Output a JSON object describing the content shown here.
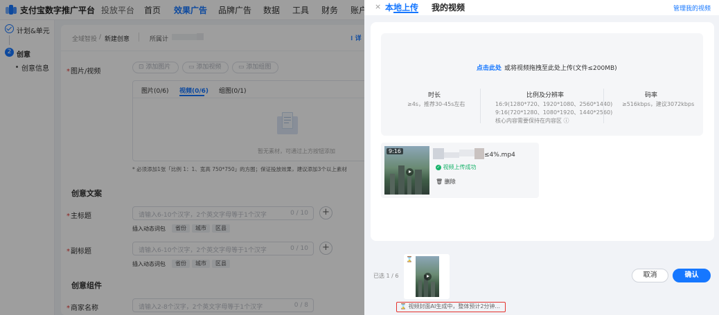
{
  "app": {
    "title": "支付宝数字推广平台",
    "subtitle": "投放平台"
  },
  "nav": [
    "首页",
    "效果广告",
    "品牌广告",
    "数据",
    "工具",
    "财务",
    "账户"
  ],
  "sidebar": {
    "step1": "计划&单元",
    "step2_num": "2",
    "step2": "创意",
    "sub": "创意信息"
  },
  "breadcrumb": {
    "root": "全域智投",
    "sep": "/",
    "current": "新建创意",
    "owner_label": "所属计",
    "detail": "详"
  },
  "media": {
    "label": "图片/视频",
    "buttons": [
      "添加图片",
      "添加视频",
      "添加组图"
    ],
    "tabs": [
      "图片(0/6)",
      "视频(0/6)",
      "组图(0/1)"
    ],
    "empty_text": "暂无素材，可通过上方按钮添加",
    "hint": "* 必须添加1张「比例 1：1、宽高 750*750」的方图；保证投放效果，建议添加3个以上素材"
  },
  "copy": {
    "section_title": "创意文案",
    "main_title": {
      "label": "主标题",
      "placeholder": "请输入6-10个汉字，2个英文字母等于1个汉字",
      "count": "0 / 10"
    },
    "sub_title": {
      "label": "副标题",
      "placeholder": "请输入6-10个汉字，2个英文字母等于1个汉字",
      "count": "0 / 10"
    },
    "insert_label": "插入动态词包",
    "tags": [
      "省份",
      "城市",
      "区县"
    ]
  },
  "components": {
    "section_title": "创意组件",
    "merchant": {
      "label": "商家名称",
      "placeholder": "请输入2-8个汉字，2个英文字母等于1个汉字",
      "count": "0 / 8"
    }
  },
  "drawer": {
    "close": "×",
    "tabs": [
      "本地上传",
      "我的视频"
    ],
    "manage_link": "管理我的视频",
    "upload_link": "点击此处",
    "upload_text": "或将视频拖拽至此处上传(文件≤200MB)",
    "specs": [
      {
        "title": "时长",
        "lines": [
          "≥4s，推荐30-45s左右"
        ]
      },
      {
        "title": "比例及分辨率",
        "lines": [
          "16:9(1280*720、1920*1080、2560*1440)",
          "9:16(720*1280、1080*1920、1440*2560)",
          "核心内容需要保持在内容区 ⓘ"
        ]
      },
      {
        "title": "码率",
        "lines": [
          "≥516kbps，建议3072kbps"
        ]
      }
    ],
    "file": {
      "duration": "9:16",
      "name_suffix": "≤4%.mp4",
      "status": "视频上传成功",
      "delete": "删除"
    },
    "footer": {
      "selected": "已选 1 / 6",
      "cancel": "取消",
      "confirm": "确认",
      "generating": "视频封面AI生成中，整体预计2分钟..."
    }
  },
  "colors": {
    "accent": "#1677ff",
    "success": "#19b36b",
    "required": "#e53935",
    "highlight": "#e5322d"
  }
}
